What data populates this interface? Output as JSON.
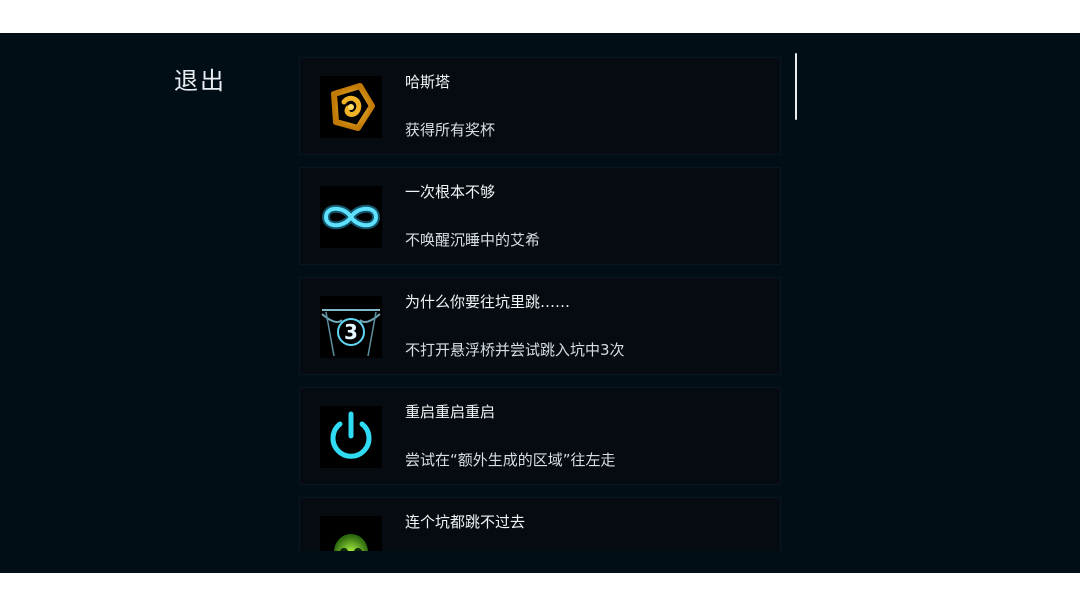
{
  "nav": {
    "back_label": "退出"
  },
  "achievements": [
    {
      "title": "哈斯塔",
      "description": "获得所有奖杯",
      "icon": "golden-sigil-icon",
      "icon_color": "#e2a21b"
    },
    {
      "title": "一次根本不够",
      "description": "不唤醒沉睡中的艾希",
      "icon": "infinity-icon",
      "icon_color": "#37c9f0"
    },
    {
      "title": "为什么你要往坑里跳……",
      "description": "不打开悬浮桥并尝试跳入坑中3次",
      "icon": "bridge-pit-icon",
      "icon_text": "3",
      "icon_color": "#5fd6f2"
    },
    {
      "title": "重启重启重启",
      "description": "尝试在“额外生成的区域”往左走",
      "icon": "power-icon",
      "icon_color": "#2fdcf4"
    },
    {
      "title": "连个坑都跳不过去",
      "description": "",
      "icon": "green-skull-icon",
      "icon_color": "#7ed321"
    }
  ],
  "colors": {
    "background": "#020e15",
    "card": "#050b10",
    "text": "#f1f4f6"
  }
}
